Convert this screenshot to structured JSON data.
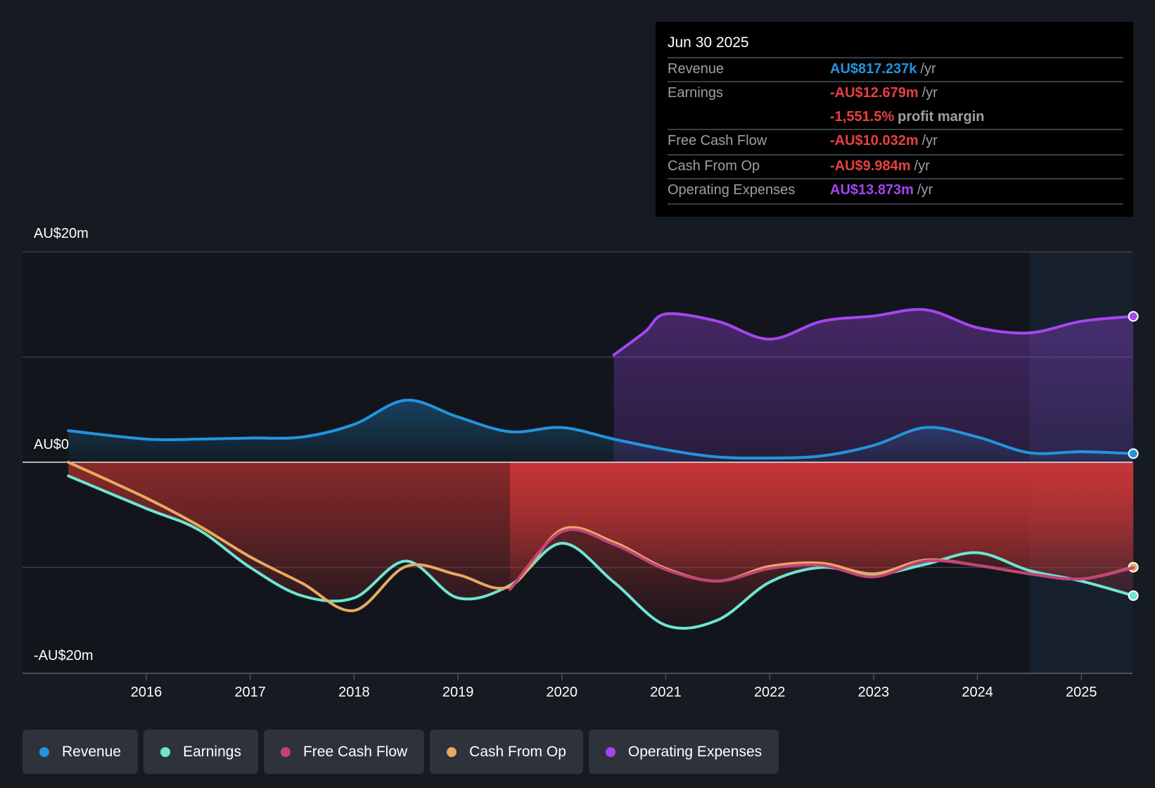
{
  "tooltip": {
    "date": "Jun 30 2025",
    "rows": [
      {
        "label": "Revenue",
        "value": "AU$817.237k",
        "unit": "/yr",
        "color": "#2394df"
      },
      {
        "label": "Earnings",
        "value": "-AU$12.679m",
        "unit": "/yr",
        "color": "#e64141",
        "extra_value": "-1,551.5%",
        "extra_unit": "profit margin"
      },
      {
        "label": "Free Cash Flow",
        "value": "-AU$10.032m",
        "unit": "/yr",
        "color": "#e64141"
      },
      {
        "label": "Cash From Op",
        "value": "-AU$9.984m",
        "unit": "/yr",
        "color": "#e64141"
      },
      {
        "label": "Operating Expenses",
        "value": "AU$13.873m",
        "unit": "/yr",
        "color": "#a546f0"
      }
    ]
  },
  "chart_data": {
    "type": "line",
    "ylabel_top": "AU$20m",
    "ylabel_zero": "AU$0",
    "ylabel_bottom": "-AU$20m",
    "ylim": [
      -20,
      20
    ],
    "xlim": [
      2015.0,
      2025.5
    ],
    "forecast_start": 2024.5,
    "x_ticks": [
      "2016",
      "2017",
      "2018",
      "2019",
      "2020",
      "2021",
      "2022",
      "2023",
      "2024",
      "2025"
    ],
    "series": [
      {
        "name": "Revenue",
        "color": "#2394df",
        "x": [
          2015.25,
          2016,
          2016.5,
          2017,
          2017.5,
          2018,
          2018.5,
          2019,
          2019.5,
          2020,
          2020.5,
          2021,
          2021.5,
          2022,
          2022.5,
          2023,
          2023.5,
          2024,
          2024.5,
          2025,
          2025.5
        ],
        "values": [
          3.0,
          2.2,
          2.2,
          2.3,
          2.4,
          3.6,
          5.9,
          4.3,
          2.9,
          3.3,
          2.2,
          1.2,
          0.5,
          0.4,
          0.6,
          1.6,
          3.3,
          2.4,
          0.9,
          1.0,
          0.82
        ]
      },
      {
        "name": "Earnings",
        "color": "#6ee5d2",
        "x": [
          2015.25,
          2016,
          2016.5,
          2017,
          2017.5,
          2018,
          2018.5,
          2019,
          2019.5,
          2020,
          2020.5,
          2021,
          2021.5,
          2022,
          2022.5,
          2023,
          2023.5,
          2024,
          2024.5,
          2025,
          2025.5
        ],
        "values": [
          -1.3,
          -4.4,
          -6.4,
          -10.0,
          -12.7,
          -12.9,
          -9.4,
          -12.9,
          -11.7,
          -7.7,
          -11.4,
          -15.5,
          -15.0,
          -11.4,
          -10.0,
          -10.7,
          -9.7,
          -8.6,
          -10.3,
          -11.3,
          -12.68
        ]
      },
      {
        "name": "Free Cash Flow",
        "color": "#c2427a",
        "x": [
          2019.5,
          2020,
          2020.5,
          2021,
          2021.5,
          2022,
          2022.5,
          2023,
          2023.5,
          2024,
          2024.5,
          2025,
          2025.5
        ],
        "values": [
          -12.1,
          -6.6,
          -7.8,
          -10.2,
          -11.3,
          -10.1,
          -9.8,
          -10.9,
          -9.4,
          -9.8,
          -10.6,
          -11.1,
          -10.03
        ]
      },
      {
        "name": "Cash From Op",
        "color": "#e8aa5f",
        "x": [
          2015.25,
          2016,
          2016.5,
          2017,
          2017.5,
          2018,
          2018.5,
          2019,
          2019.5,
          2020,
          2020.5,
          2021,
          2021.5,
          2022,
          2022.5,
          2023,
          2023.5,
          2024,
          2024.5,
          2025,
          2025.5
        ],
        "values": [
          0.0,
          -3.4,
          -6.0,
          -9.0,
          -11.5,
          -14.1,
          -9.9,
          -10.7,
          -11.8,
          -6.4,
          -7.6,
          -10.1,
          -11.3,
          -9.9,
          -9.6,
          -10.6,
          -9.3,
          -9.8,
          -10.6,
          -11.1,
          -9.98
        ]
      },
      {
        "name": "Operating Expenses",
        "color": "#a546f0",
        "x": [
          2020.5,
          2020.8,
          2021,
          2021.5,
          2022,
          2022.5,
          2023,
          2023.5,
          2024,
          2024.5,
          2025,
          2025.5
        ],
        "values": [
          10.2,
          12.4,
          14.1,
          13.4,
          11.7,
          13.4,
          13.9,
          14.5,
          12.8,
          12.3,
          13.4,
          13.87
        ]
      }
    ]
  }
}
